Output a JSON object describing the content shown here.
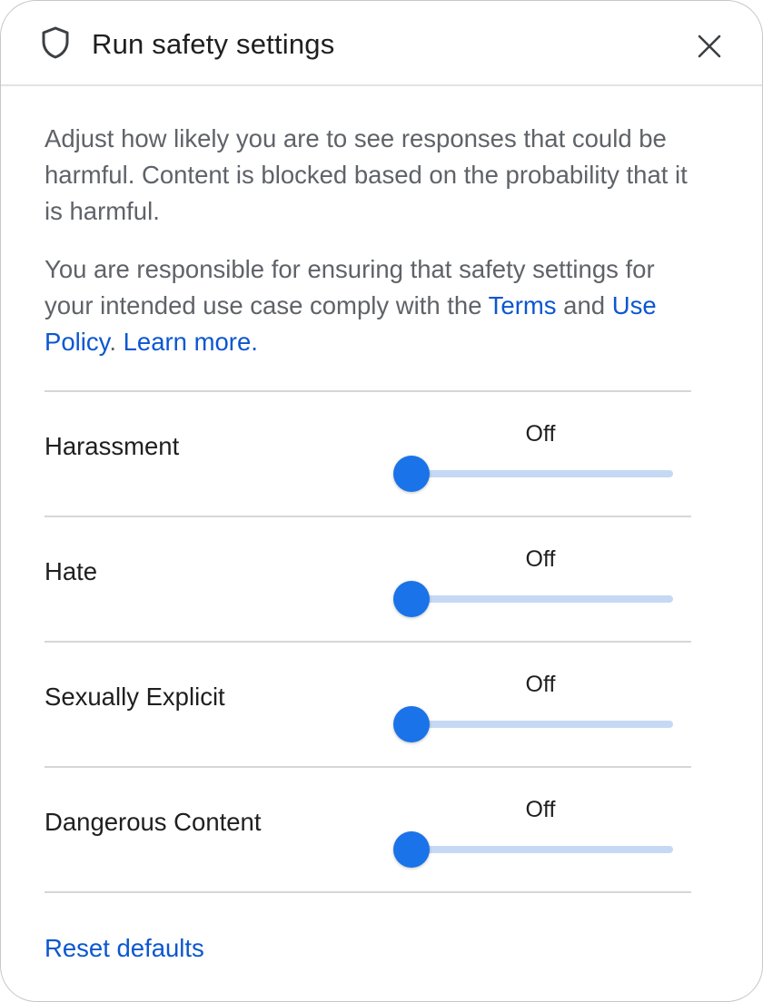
{
  "dialog": {
    "title": "Run safety settings",
    "title_icon": "shield-icon",
    "close_icon": "close-icon"
  },
  "description": {
    "paragraph1": "Adjust how likely you are to see responses that could be harmful. Content is blocked based on the probability that it is harmful.",
    "paragraph2_before_terms": "You are responsible for ensuring that safety settings for your intended use case comply with the ",
    "terms_link": "Terms",
    "paragraph2_between": " and ",
    "use_policy_link": "Use Policy",
    "paragraph2_after_policy": ". ",
    "learn_more_link": "Learn more",
    "paragraph2_end": "."
  },
  "settings": [
    {
      "label": "Harassment",
      "value_label": "Off",
      "level": 0
    },
    {
      "label": "Hate",
      "value_label": "Off",
      "level": 0
    },
    {
      "label": "Sexually Explicit",
      "value_label": "Off",
      "level": 0
    },
    {
      "label": "Dangerous Content",
      "value_label": "Off",
      "level": 0
    }
  ],
  "footer": {
    "reset_label": "Reset defaults"
  },
  "colors": {
    "accent": "#1a73e8",
    "link": "#0b57d0",
    "track": "#c6d9f4"
  }
}
